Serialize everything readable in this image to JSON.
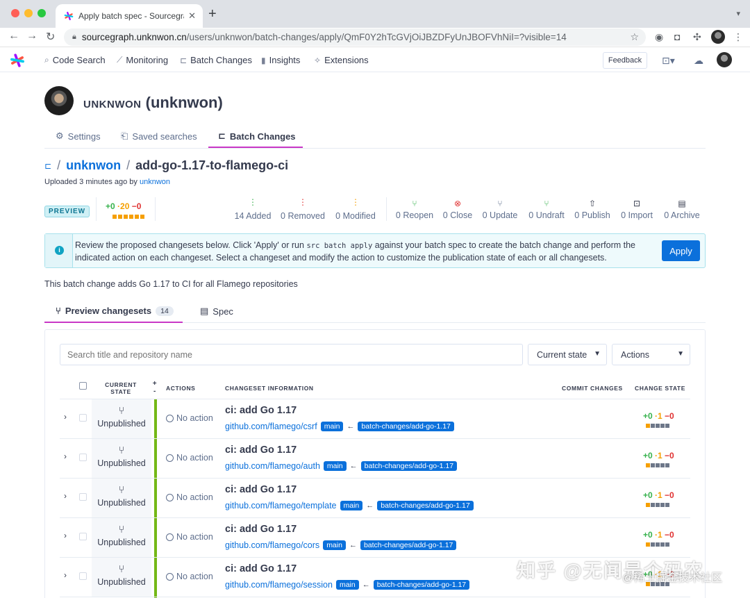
{
  "browser": {
    "tab_title": "Apply batch spec - Sourcegraph",
    "url_host": "sourcegraph.unknwon.cn",
    "url_path": "/users/unknwon/batch-changes/apply/QmF0Y2hTcGVjOiJBZDFyUnJBOFVhNiI=?visible=14"
  },
  "nav": {
    "items": [
      {
        "icon": "search-icon",
        "label": "Code Search"
      },
      {
        "icon": "monitoring-icon",
        "label": "Monitoring"
      },
      {
        "icon": "batch-changes-icon",
        "label": "Batch Changes"
      },
      {
        "icon": "insights-icon",
        "label": "Insights"
      },
      {
        "icon": "extensions-icon",
        "label": "Extensions"
      }
    ],
    "feedback_label": "Feedback"
  },
  "profile": {
    "display_name": "unknwon",
    "username": "(unknwon)"
  },
  "sub_tabs": {
    "settings": "Settings",
    "saved_searches": "Saved searches",
    "batch_changes": "Batch Changes"
  },
  "batch_spec": {
    "namespace": "unknwon",
    "name": "add-go-1.17-to-flamego-ci",
    "uploaded_prefix": "Uploaded 3 minutes ago by",
    "uploaded_by": "unknwon",
    "preview_badge": "PREVIEW",
    "diff": {
      "added": "+0",
      "changed": "·20",
      "deleted": "−0"
    },
    "description": "This batch change adds Go 1.17 to CI for all Flamego repositories"
  },
  "stats": [
    {
      "icon": "added-icon",
      "glyph": "+",
      "label": "14 Added",
      "color": "#37b24d"
    },
    {
      "icon": "removed-icon",
      "glyph": "−",
      "label": "0 Removed",
      "color": "#e03131"
    },
    {
      "icon": "modified-icon",
      "glyph": "•",
      "label": "0 Modified",
      "color": "#f59f00"
    },
    {
      "icon": "reopen-icon",
      "glyph": "⑂",
      "label": "0 Reopen",
      "color": "#37b24d"
    },
    {
      "icon": "close-icon",
      "glyph": "⊗",
      "label": "0 Close",
      "color": "#e03131"
    },
    {
      "icon": "update-icon",
      "glyph": "⑂",
      "label": "0 Update",
      "color": "#5e6e8c"
    },
    {
      "icon": "undraft-icon",
      "glyph": "⑂",
      "label": "0 Undraft",
      "color": "#37b24d"
    },
    {
      "icon": "publish-icon",
      "glyph": "⇧",
      "label": "0 Publish",
      "color": "#343a4d"
    },
    {
      "icon": "import-icon",
      "glyph": "⊡",
      "label": "0 Import",
      "color": "#343a4d"
    },
    {
      "icon": "archive-icon",
      "glyph": "▤",
      "label": "0 Archive",
      "color": "#343a4d"
    }
  ],
  "alert": {
    "text_before": "Review the proposed changesets below. Click 'Apply' or run",
    "code": "src batch apply",
    "text_after": "against your batch spec to create the batch change and perform the indicated action on each changeset. Select a changeset and modify the action to customize the publication state of each or all changesets.",
    "apply_label": "Apply"
  },
  "preview_tabs": {
    "changesets_label": "Preview changesets",
    "changesets_count": "14",
    "spec_label": "Spec"
  },
  "filters": {
    "search_placeholder": "Search title and repository name",
    "state_select": "Current state",
    "actions_select": "Actions"
  },
  "table": {
    "headers": {
      "current_state": "CURRENT STATE",
      "plus_minus": "+ -",
      "actions": "ACTIONS",
      "info": "CHANGESET INFORMATION",
      "commit": "COMMIT CHANGES",
      "change_state": "CHANGE STATE"
    },
    "rows": [
      {
        "state": "Unpublished",
        "action": "No action",
        "title": "ci: add Go 1.17",
        "repo": "github.com/flamego/csrf",
        "base": "main",
        "head": "batch-changes/add-go-1.17",
        "diff": {
          "a": "+0",
          "c": "·1",
          "d": "−0"
        }
      },
      {
        "state": "Unpublished",
        "action": "No action",
        "title": "ci: add Go 1.17",
        "repo": "github.com/flamego/auth",
        "base": "main",
        "head": "batch-changes/add-go-1.17",
        "diff": {
          "a": "+0",
          "c": "·1",
          "d": "−0"
        }
      },
      {
        "state": "Unpublished",
        "action": "No action",
        "title": "ci: add Go 1.17",
        "repo": "github.com/flamego/template",
        "base": "main",
        "head": "batch-changes/add-go-1.17",
        "diff": {
          "a": "+0",
          "c": "·1",
          "d": "−0"
        }
      },
      {
        "state": "Unpublished",
        "action": "No action",
        "title": "ci: add Go 1.17",
        "repo": "github.com/flamego/cors",
        "base": "main",
        "head": "batch-changes/add-go-1.17",
        "diff": {
          "a": "+0",
          "c": "·1",
          "d": "−0"
        }
      },
      {
        "state": "Unpublished",
        "action": "No action",
        "title": "ci: add Go 1.17",
        "repo": "github.com/flamego/session",
        "base": "main",
        "head": "batch-changes/add-go-1.17",
        "diff": {
          "a": "+0",
          "c": "·1",
          "d": "−0"
        }
      }
    ]
  },
  "watermark": {
    "main": "知乎 @无闻是个码农",
    "sub": "@稀土掘金技术社区"
  }
}
